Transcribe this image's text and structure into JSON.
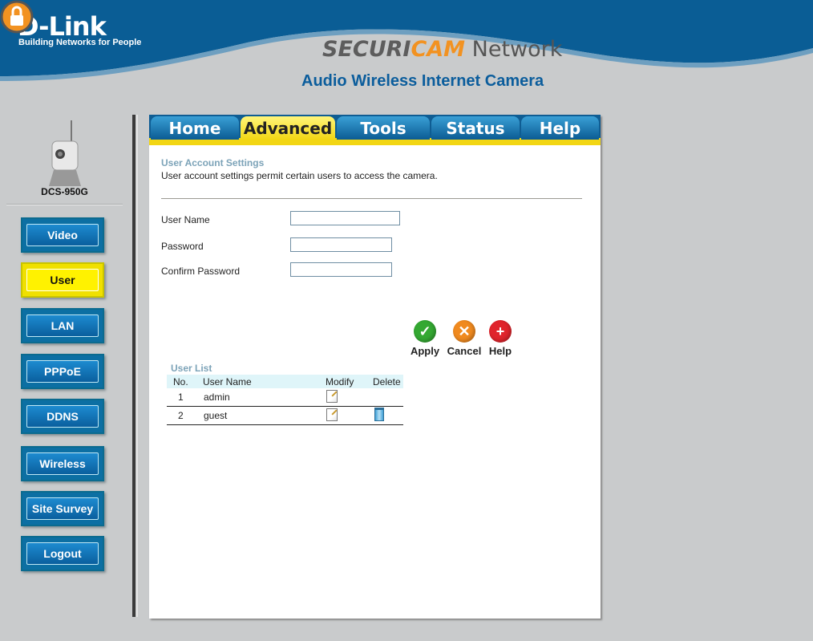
{
  "header": {
    "brand": "D-Link",
    "tagline": "Building Networks for People",
    "product_part1": "SECURI",
    "product_part2": "CAM",
    "product_part3": " Network",
    "subtitle": "Audio Wireless Internet Camera"
  },
  "sidebar": {
    "model": "DCS-950G",
    "items": [
      {
        "label": "Video",
        "active": false
      },
      {
        "label": "User",
        "active": true
      },
      {
        "label": "LAN",
        "active": false
      },
      {
        "label": "PPPoE",
        "active": false
      },
      {
        "label": "DDNS",
        "active": false
      },
      {
        "label": "Wireless",
        "active": false
      },
      {
        "label": "Site Survey",
        "active": false
      },
      {
        "label": "Logout",
        "active": false
      }
    ]
  },
  "tabs": [
    {
      "label": "Home",
      "active": false
    },
    {
      "label": "Advanced",
      "active": true
    },
    {
      "label": "Tools",
      "active": false
    },
    {
      "label": "Status",
      "active": false
    },
    {
      "label": "Help",
      "active": false
    }
  ],
  "settings": {
    "title": "User Account Settings",
    "description": "User account settings permit certain users to access the camera.",
    "fields": {
      "username_label": "User Name",
      "username_value": "",
      "password_label": "Password",
      "password_value": "",
      "confirm_label": "Confirm Password",
      "confirm_value": ""
    }
  },
  "actions": {
    "apply": "Apply",
    "cancel": "Cancel",
    "help": "Help"
  },
  "user_list": {
    "title": "User List",
    "columns": [
      "No.",
      "User Name",
      "Modify",
      "Delete"
    ],
    "rows": [
      {
        "no": "1",
        "name": "admin",
        "deletable": false
      },
      {
        "no": "2",
        "name": "guest",
        "deletable": true
      }
    ]
  },
  "colors": {
    "brand_blue": "#0b5d9c",
    "accent_orange": "#f29221",
    "active_yellow": "#fff200",
    "apply_green": "#34a832",
    "cancel_orange": "#f08a1f",
    "help_red": "#e0242c"
  }
}
